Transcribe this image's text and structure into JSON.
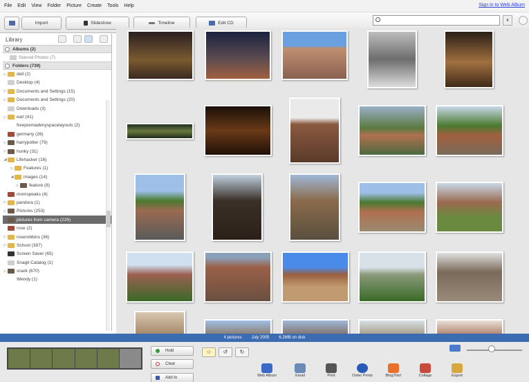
{
  "menu": [
    "File",
    "Edit",
    "View",
    "Folder",
    "Picture",
    "Create",
    "Tools",
    "Help"
  ],
  "sign_in": "Sign in to Web Album",
  "toolbar": {
    "import": "Import",
    "slideshow": "Slideshow",
    "timeline": "Timeline",
    "edit_cd": "Edit CD",
    "close_x": "x"
  },
  "sidebar": {
    "title": "Library",
    "albums_section": "Albums (2)",
    "starred": "Starred Photos (7)",
    "folders_section": "Folders (739)",
    "folders": [
      {
        "label": "dell (2)"
      },
      {
        "label": "Desktop (4)"
      },
      {
        "label": "Documents and Settings (15)"
      },
      {
        "label": "Documents and Settings (20)"
      },
      {
        "label": "Downloads (3)"
      },
      {
        "label": "earl (41)"
      },
      {
        "label": "freepremadenyspacelayouts (2)"
      },
      {
        "label": "germany (26)"
      },
      {
        "label": "harrypotter (79)"
      },
      {
        "label": "hunky (31)"
      },
      {
        "label": "Lifehacker (16)"
      },
      {
        "label": "Features (1)"
      },
      {
        "label": "images (14)"
      },
      {
        "label": "feature (8)"
      },
      {
        "label": "momspeaks (4)"
      },
      {
        "label": "pandora (1)"
      },
      {
        "label": "Pictures (253)"
      },
      {
        "label": "pictures from camera (226)"
      },
      {
        "label": "rose (2)"
      },
      {
        "label": "roserobbins (36)"
      },
      {
        "label": "School (397)"
      },
      {
        "label": "Screen Saver (65)"
      },
      {
        "label": "Snagit Catalog (1)"
      },
      {
        "label": "snark (670)"
      },
      {
        "label": "Wendy (1)"
      }
    ]
  },
  "status": {
    "count": "4 pictures",
    "date": "July 2005",
    "size": "6.2MB on disk"
  },
  "tray": {
    "hold": "Hold",
    "clear": "Clear",
    "add_to": "Add to",
    "actions": [
      "Web Album",
      "Email",
      "Print",
      "Order Prints",
      "BlogThis!",
      "Collage",
      "Export"
    ]
  },
  "colors": {
    "status_bar": "#3b6bb0",
    "selected_row": "#6b6b6b",
    "accent_link": "#2b3fd6"
  }
}
